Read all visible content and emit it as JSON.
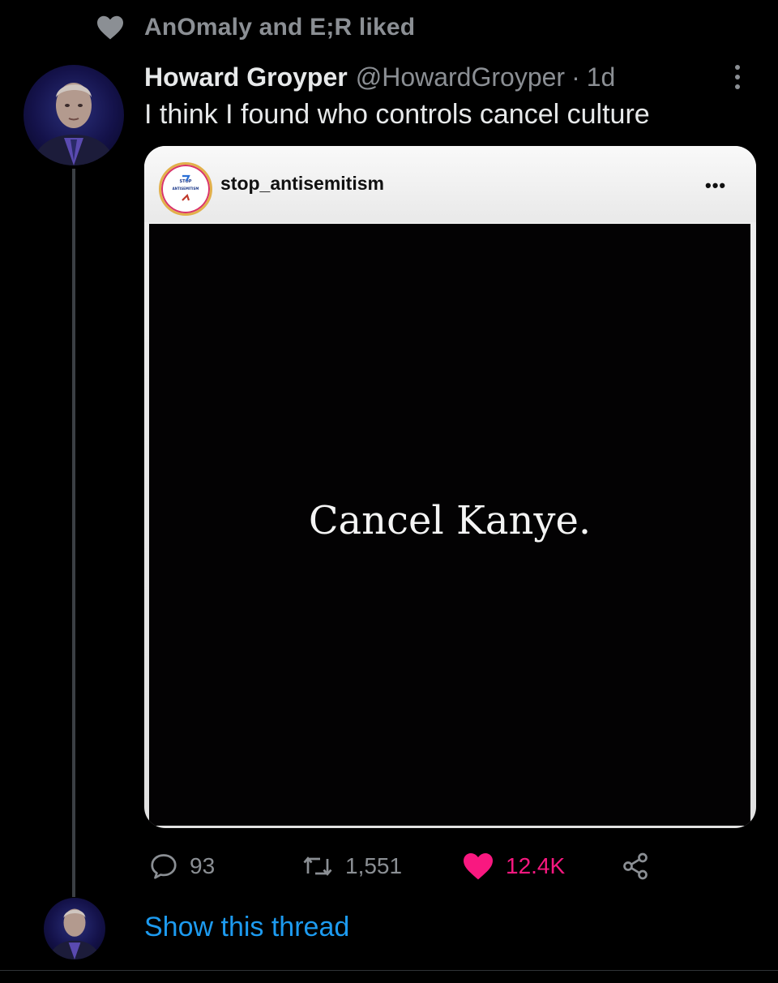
{
  "social_context": {
    "text": "AnOmaly and E;R liked",
    "icon": "heart-icon"
  },
  "tweet": {
    "author_name": "Howard Groyper",
    "author_handle": "@HowardGroyper",
    "separator": "·",
    "age": "1d",
    "text": "I think I found who controls cancel culture",
    "more_icon": "more-vertical-icon"
  },
  "embedded_post": {
    "username": "stop_antisemitism",
    "more": "•••",
    "logo_text_top": "STOP",
    "logo_text_bottom": "ANTISEMITISM",
    "image_caption": "Cancel Kanye."
  },
  "actions": {
    "replies": "93",
    "retweets": "1,551",
    "likes": "12.4K",
    "icons": [
      "reply-icon",
      "retweet-icon",
      "like-icon",
      "share-icon"
    ]
  },
  "show_thread_label": "Show this thread",
  "colors": {
    "background": "#000000",
    "text_primary": "#e7e9ea",
    "text_secondary": "#8b8f94",
    "like_pink": "#f91880",
    "link_blue": "#1d9bf0"
  }
}
